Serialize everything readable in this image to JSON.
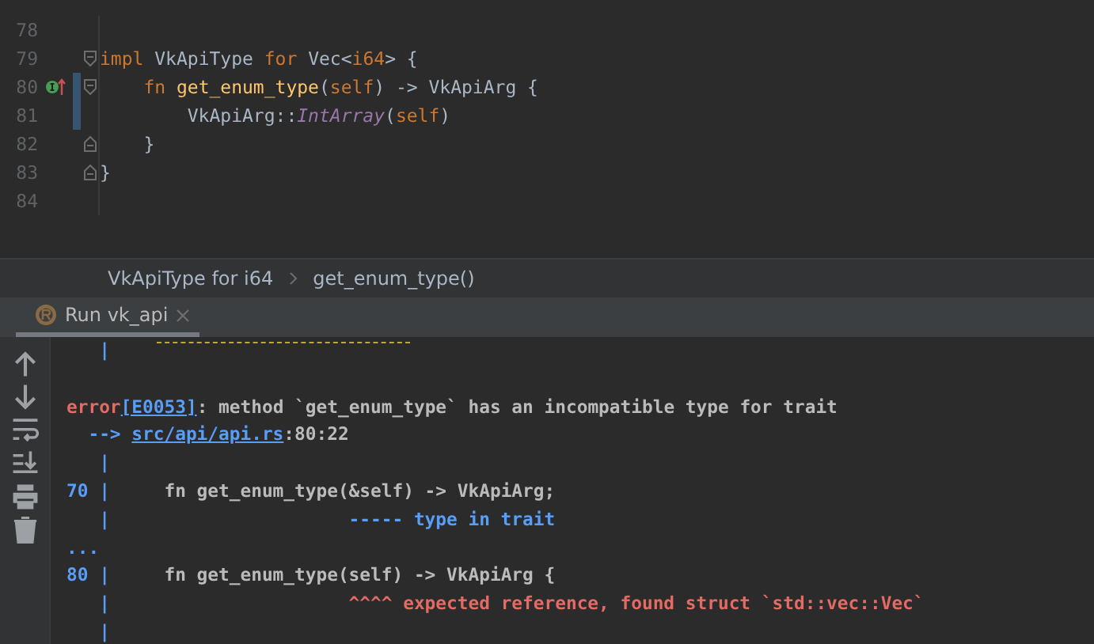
{
  "editor": {
    "lines": [
      {
        "number": "78",
        "fold_start": false,
        "fold_end": false,
        "marker": false,
        "icon": false
      },
      {
        "number": "79",
        "fold_start": true,
        "fold_end": false,
        "marker": false,
        "icon": false,
        "tokens": [
          {
            "kind": "keyword",
            "text": "impl"
          },
          {
            "kind": "plain",
            "text": " VkApiType "
          },
          {
            "kind": "keyword",
            "text": "for"
          },
          {
            "kind": "plain",
            "text": " Vec<"
          },
          {
            "kind": "keyword",
            "text": "i64"
          },
          {
            "kind": "plain",
            "text": "> {"
          }
        ]
      },
      {
        "number": "80",
        "fold_start": true,
        "fold_end": false,
        "marker": true,
        "icon": true,
        "tokens": [
          {
            "kind": "keyword",
            "text": "    fn"
          },
          {
            "kind": "function",
            "text": " get_enum_type"
          },
          {
            "kind": "plain",
            "text": "("
          },
          {
            "kind": "keyword",
            "text": "self"
          },
          {
            "kind": "plain",
            "text": ") -> VkApiArg {"
          }
        ]
      },
      {
        "number": "81",
        "fold_start": false,
        "fold_end": false,
        "marker": true,
        "icon": false,
        "tokens": [
          {
            "kind": "plain",
            "text": "        VkApiArg::"
          },
          {
            "kind": "variant",
            "text": "IntArray"
          },
          {
            "kind": "plain",
            "text": "("
          },
          {
            "kind": "keyword",
            "text": "self"
          },
          {
            "kind": "plain",
            "text": ")"
          }
        ]
      },
      {
        "number": "82",
        "fold_start": false,
        "fold_end": true,
        "marker": false,
        "icon": false,
        "tokens": [
          {
            "kind": "plain",
            "text": "    }"
          }
        ]
      },
      {
        "number": "83",
        "fold_start": false,
        "fold_end": true,
        "marker": false,
        "icon": false,
        "tokens": [
          {
            "kind": "plain",
            "text": "}"
          }
        ]
      },
      {
        "number": "84",
        "fold_start": false,
        "fold_end": false,
        "marker": false,
        "icon": false
      }
    ]
  },
  "breadcrumbs": [
    "VkApiType for i64",
    "get_enum_type()"
  ],
  "run_tab": {
    "label": "Run vk_api",
    "selected": true
  },
  "console": {
    "lines": [
      {
        "underline": true,
        "segments": [
          {
            "kind": "gutter",
            "text": "   |"
          }
        ]
      },
      {
        "underline": false
      },
      {
        "underline": false,
        "segments": [
          {
            "kind": "error",
            "text": "error"
          },
          {
            "kind": "link",
            "text": "[E0053]"
          },
          {
            "kind": "plain",
            "text": ": method `get_enum_type` has an incompatible type for trait"
          }
        ]
      },
      {
        "underline": false,
        "segments": [
          {
            "kind": "gutter",
            "text": "  --> "
          },
          {
            "kind": "link",
            "text": "src/api/api.rs"
          },
          {
            "kind": "plain",
            "text": ":80:22"
          }
        ]
      },
      {
        "underline": false,
        "segments": [
          {
            "kind": "gutter",
            "text": "   |"
          }
        ]
      },
      {
        "underline": false,
        "segments": [
          {
            "kind": "gutter",
            "text": "70 |"
          },
          {
            "kind": "plain",
            "text": "     fn get_enum_type(&self) -> VkApiArg;"
          }
        ]
      },
      {
        "underline": false,
        "segments": [
          {
            "kind": "gutter",
            "text": "   |                      ----- type in trait"
          }
        ]
      },
      {
        "underline": false,
        "segments": [
          {
            "kind": "gutter",
            "text": "..."
          }
        ]
      },
      {
        "underline": false,
        "segments": [
          {
            "kind": "gutter",
            "text": "80 |"
          },
          {
            "kind": "plain",
            "text": "     fn get_enum_type(self) -> VkApiArg {"
          }
        ]
      },
      {
        "underline": false,
        "segments": [
          {
            "kind": "gutter",
            "text": "   |"
          },
          {
            "kind": "error",
            "text": "                      ^^^^ expected reference, found struct `std::vec::Vec`"
          }
        ]
      },
      {
        "underline": false,
        "segments": [
          {
            "kind": "gutter",
            "text": "   |"
          }
        ]
      }
    ]
  }
}
